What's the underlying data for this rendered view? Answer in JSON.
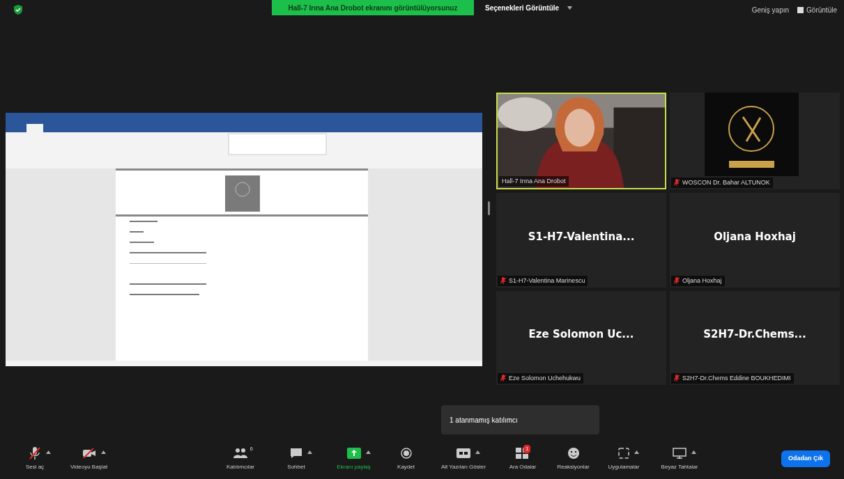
{
  "top_bar": {
    "share_banner": "Hall-7 Irına Ana Drobot ekranını görüntülüyorsunuz",
    "view_options": "Seçenekleri Görüntüle",
    "enlarge": "Geniş yapın",
    "view": "Görüntüle"
  },
  "tiles": [
    {
      "kind": "video",
      "label": "Hall-7 Irına Ana Drobot",
      "muted": false,
      "active_speaker": true
    },
    {
      "kind": "logo",
      "label": "WOSCON Dr. Bahar ALTUNOK",
      "muted": true,
      "active_speaker": false
    },
    {
      "kind": "name",
      "big_name": "S1-H7-Valentina...",
      "label": "S1-H7-Valentina Marinescu",
      "muted": true,
      "active_speaker": false
    },
    {
      "kind": "name",
      "big_name": "Oljana Hoxhaj",
      "label": "Oljana Hoxhaj",
      "muted": true,
      "active_speaker": false
    },
    {
      "kind": "name",
      "big_name": "Eze Solomon Uc...",
      "label": "Eze Solomon Uchehukwu",
      "muted": true,
      "active_speaker": false
    },
    {
      "kind": "name",
      "big_name": "S2H7-Dr.Chems...",
      "label": "S2H7-Dr.Chems Eddine BOUKHEDIMI",
      "muted": true,
      "active_speaker": false
    }
  ],
  "tooltip": "1 atanmamış katılımcı",
  "toolbar": [
    {
      "kind": "mic",
      "label": "Sesi aç",
      "menu": true
    },
    {
      "kind": "video",
      "label": "Videoyu Başlat",
      "menu": true
    },
    {
      "kind": "people",
      "label": "Katılımcılar",
      "count": "6",
      "menu": false
    },
    {
      "kind": "chat",
      "label": "Sohbet",
      "menu": true
    },
    {
      "kind": "share",
      "label": "Ekranı paylaş",
      "menu": true
    },
    {
      "kind": "record",
      "label": "Kaydet",
      "menu": false
    },
    {
      "kind": "cc",
      "label": "Alt Yazıları Göster",
      "menu": true
    },
    {
      "kind": "rooms",
      "label": "Ara Odalar",
      "badge": "1",
      "menu": false
    },
    {
      "kind": "emoji",
      "label": "Reaksiyonlar",
      "menu": false
    },
    {
      "kind": "apps",
      "label": "Uygulamalar",
      "menu": true
    },
    {
      "kind": "board",
      "label": "Beyaz Tahtalar",
      "menu": true
    }
  ],
  "leave_button": "Odadan Çık"
}
